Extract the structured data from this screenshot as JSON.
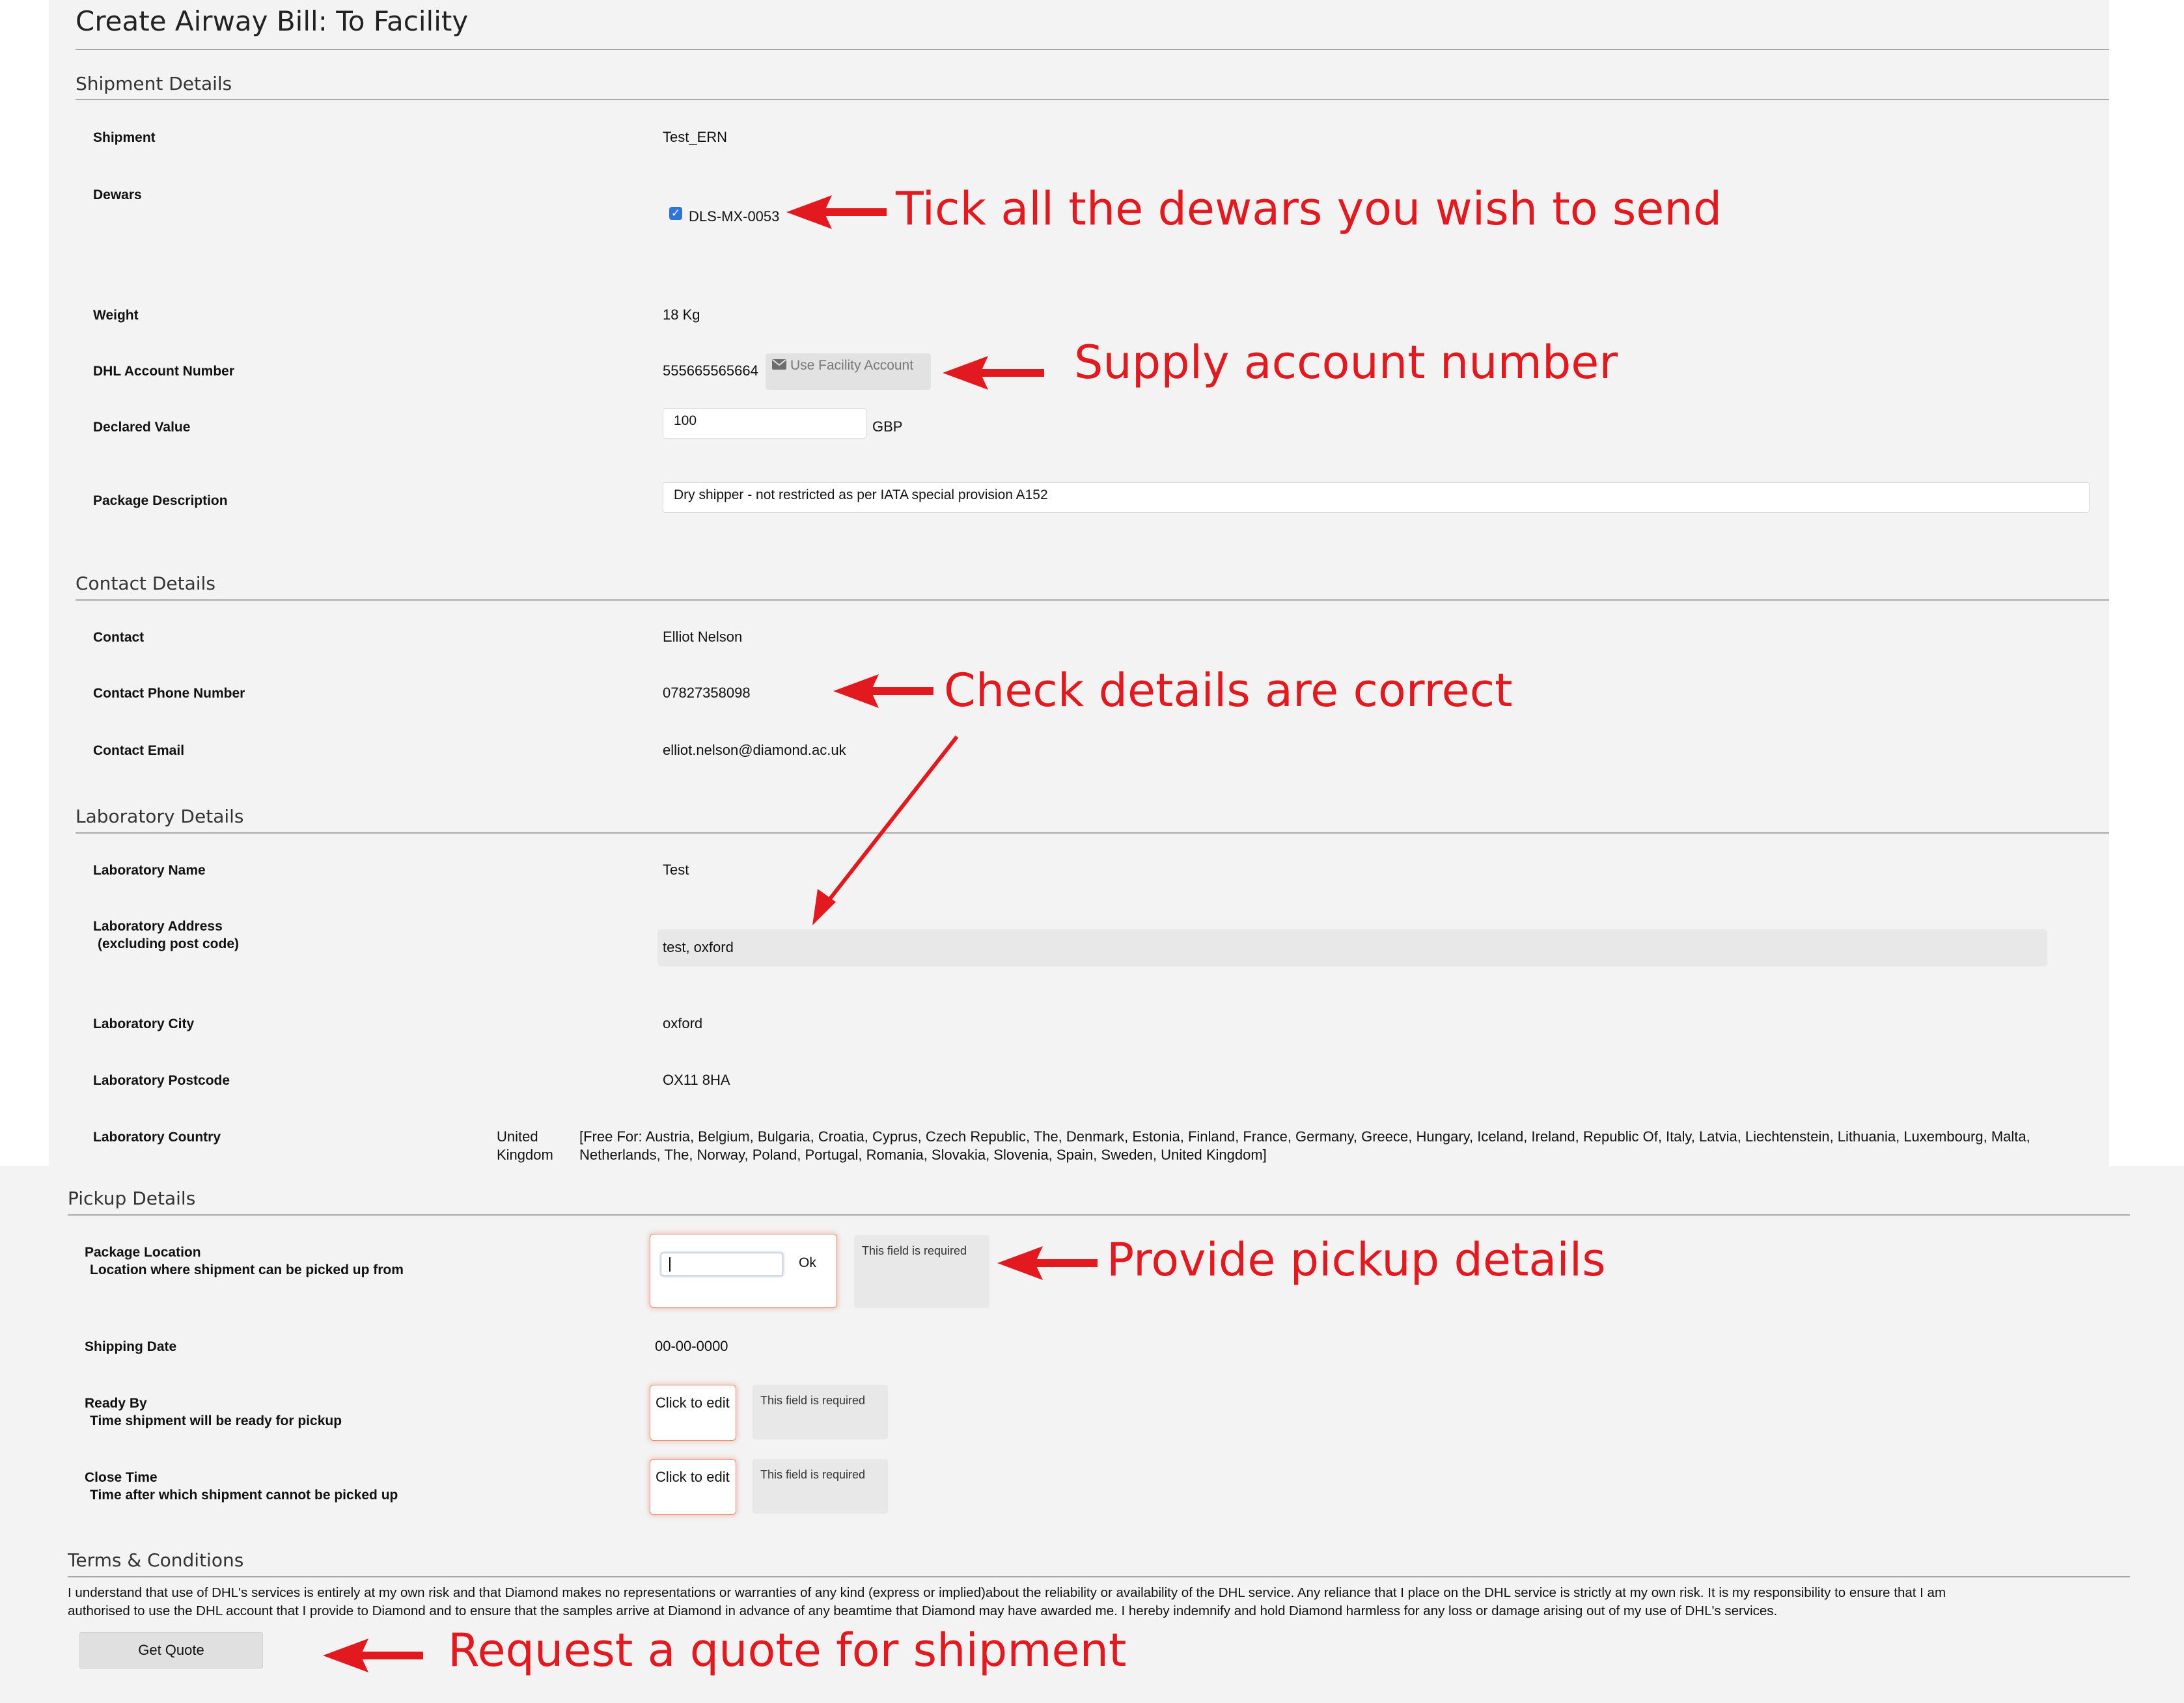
{
  "page": {
    "title": "Create Airway Bill: To Facility"
  },
  "sections": {
    "shipment": "Shipment Details",
    "contact": "Contact Details",
    "laboratory": "Laboratory Details",
    "pickup": "Pickup Details",
    "terms": "Terms & Conditions"
  },
  "shipment": {
    "shipment_label": "Shipment",
    "shipment_value": "Test_ERN",
    "dewars_label": "Dewars",
    "dewar_name": "DLS-MX-0053",
    "dewar_checked": true,
    "weight_label": "Weight",
    "weight_value": "18  Kg",
    "account_label": "DHL Account Number",
    "account_value": "555665565664",
    "use_facility_label": "Use Facility Account",
    "declared_label": "Declared Value",
    "declared_value": "100",
    "currency": "GBP",
    "description_label": "Package Description",
    "description_value": "Dry shipper - not restricted as per IATA special provision A152"
  },
  "contact": {
    "contact_label": "Contact",
    "contact_value": "Elliot  Nelson",
    "phone_label": "Contact Phone Number",
    "phone_value": "07827358098",
    "email_label": "Contact Email",
    "email_value": "elliot.nelson@diamond.ac.uk"
  },
  "laboratory": {
    "name_label": "Laboratory Name",
    "name_value": "Test",
    "address_label": "Laboratory Address",
    "address_sublabel": "(excluding post code)",
    "address_value": "test, oxford",
    "city_label": "Laboratory City",
    "city_value": "oxford",
    "postcode_label": "Laboratory Postcode",
    "postcode_value": "OX11 8HA",
    "country_label": "Laboratory Country",
    "country_value_line1": "United",
    "country_value_line2": "Kingdom",
    "free_for_line1": "[Free For: Austria, Belgium, Bulgaria, Croatia, Cyprus, Czech Republic, The, Denmark, Estonia, Finland, France, Germany, Greece, Hungary, Iceland, Ireland, Republic Of, Italy, Latvia, Liechtenstein, Lithuania, Luxembourg, Malta,",
    "free_for_line2": "Netherlands, The, Norway, Poland, Portugal, Romania, Slovakia, Slovenia, Spain, Sweden, United Kingdom]"
  },
  "pickup": {
    "location_label": "Package Location",
    "location_sublabel": "Location where shipment can be picked up from",
    "ok_label": "Ok",
    "required_text": "This field is required",
    "shipping_date_label": "Shipping Date",
    "shipping_date_value": "00-00-0000",
    "ready_label": "Ready By",
    "ready_sublabel": "Time shipment will be ready for pickup",
    "close_label": "Close Time",
    "close_sublabel": "Time after which shipment cannot be picked up",
    "click_to_edit": "Click to edit"
  },
  "terms": {
    "line1": "I understand that use of DHL's services is entirely at my own risk and that Diamond makes no representations or warranties of any kind (express or implied)about the reliability or availability of the DHL service. Any reliance that I place on the DHL service is strictly at my own risk. It is my responsibility to ensure that I am",
    "line2": "authorised to use the DHL account that I provide to Diamond and to ensure that the samples arrive at Diamond in advance of any beamtime that Diamond may have awarded me. I hereby indemnify and hold Diamond harmless for any loss or damage arising out of my use of DHL's services.",
    "get_quote_label": "Get Quote"
  },
  "annotations": {
    "tick_dewars": "Tick all the dewars you wish to send",
    "supply_account": "Supply account number",
    "check_details": "Check details are correct",
    "pickup_details": "Provide pickup details",
    "request_quote": "Request a quote for shipment",
    "color": "#e2191e"
  }
}
